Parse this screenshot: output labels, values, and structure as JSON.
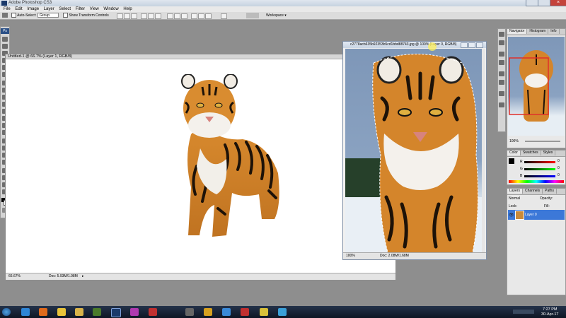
{
  "app": {
    "title": "Adobe Photoshop CS3",
    "logo": "Ps"
  },
  "menu": [
    "File",
    "Edit",
    "Image",
    "Layer",
    "Select",
    "Filter",
    "View",
    "Window",
    "Help"
  ],
  "options": {
    "auto_select_label": "Auto-Select:",
    "auto_select_value": "Group",
    "show_transform_label": "Show Transform Controls",
    "workspace_label": "Workspace"
  },
  "doc1": {
    "title": "Untitled-1 @ 66.7% (Layer 1, RGB/8)",
    "zoom": "66.67%",
    "doc_info": "Doc: 5.93M/1.98M"
  },
  "doc2": {
    "title": "c2778acb635b92353b5cd1bbd88743.jpg @ 100% (Layer 0, RGB/8)",
    "zoom": "100%",
    "doc_info": "Doc: 2.08M/1.68M"
  },
  "panels": {
    "navigator_tabs": [
      "Navigator",
      "Histogram",
      "Info"
    ],
    "navigator_zoom": "100%",
    "color_tabs": [
      "Color",
      "Swatches",
      "Styles"
    ],
    "color_labels": [
      "R",
      "G",
      "B"
    ],
    "color_values": [
      "0",
      "0",
      "0"
    ],
    "layers_tabs": [
      "Layers",
      "Channels",
      "Paths"
    ],
    "blend_mode": "Normal",
    "opacity_label": "Opacity:",
    "lock_label": "Lock:",
    "fill_label": "Fill:",
    "layer_name": "Layer 0"
  },
  "taskbar": {
    "time": "7:27 PM",
    "date": "30-Apr-17"
  },
  "colors": {
    "accent": "#3c78d8",
    "taskbar": "#172234",
    "close": "#c4433b"
  }
}
